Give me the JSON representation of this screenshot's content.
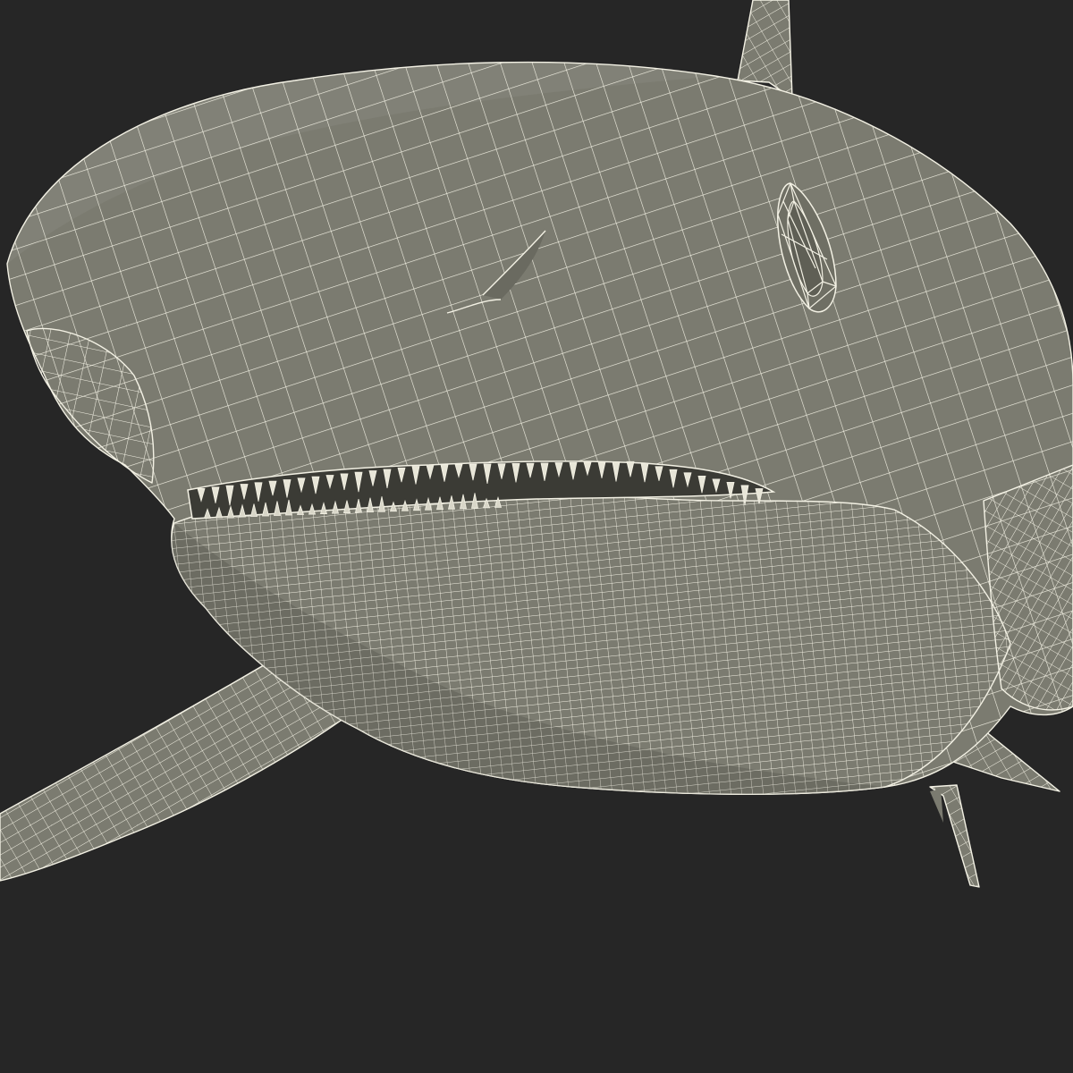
{
  "viewport": {
    "background_color": "#262626",
    "model_fill_color": "#7b7b70",
    "mouth_interior_color": "#3b3b35",
    "wire_color": "#f3f1e4",
    "subject": "shark-wireframe-model",
    "render_mode": "wireframe-on-shaded"
  }
}
